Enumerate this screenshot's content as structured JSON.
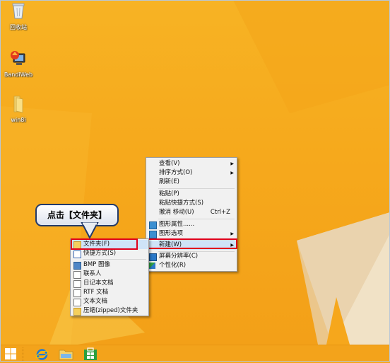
{
  "colors": {
    "desktop_bg": "#f6a71c",
    "highlight_red": "#e0001b",
    "menu_hover": "#cfe3f7"
  },
  "desktop_icons": [
    {
      "label": "回收站",
      "icon": "recycle-bin-icon"
    },
    {
      "label": "BandiWeb",
      "icon": "bandiweb-app-icon"
    },
    {
      "label": "win8i",
      "icon": "folder-icon"
    }
  ],
  "context_menu": {
    "items": [
      {
        "label": "查看(V)",
        "submenu": true
      },
      {
        "label": "排序方式(O)",
        "submenu": true
      },
      {
        "label": "刷新(E)"
      },
      {
        "label": "粘贴(P)"
      },
      {
        "label": "粘贴快捷方式(S)"
      },
      {
        "label": "撤消 移动(U)",
        "shortcut": "Ctrl+Z"
      },
      {
        "label": "图形属性......",
        "icon": "graphics-properties-icon"
      },
      {
        "label": "图形选项",
        "icon": "graphics-options-icon",
        "submenu": true
      },
      {
        "label": "新建(W)",
        "submenu": true,
        "highlighted": true
      },
      {
        "label": "屏幕分辨率(C)",
        "icon": "screen-resolution-icon"
      },
      {
        "label": "个性化(R)",
        "icon": "personalize-icon"
      }
    ]
  },
  "new_submenu": {
    "items": [
      {
        "label": "文件夹(F)",
        "icon": "folder-icon",
        "highlighted": true
      },
      {
        "label": "快捷方式(S)",
        "icon": "shortcut-icon"
      },
      {
        "label": "BMP 图像",
        "icon": "bmp-image-icon"
      },
      {
        "label": "联系人",
        "icon": "contact-icon"
      },
      {
        "label": "日记本文档",
        "icon": "journal-document-icon"
      },
      {
        "label": "RTF 文档",
        "icon": "rtf-document-icon"
      },
      {
        "label": "文本文档",
        "icon": "text-document-icon"
      },
      {
        "label": "压缩(zipped)文件夹",
        "icon": "zip-folder-icon"
      }
    ]
  },
  "callout": {
    "text": "点击【文件夹】"
  },
  "taskbar": {
    "items": [
      {
        "name": "start-button",
        "icon": "windows-logo-icon"
      },
      {
        "name": "internet-explorer",
        "icon": "internet-explorer-icon"
      },
      {
        "name": "file-explorer",
        "icon": "file-explorer-icon"
      },
      {
        "name": "windows-store",
        "icon": "store-icon"
      }
    ]
  }
}
